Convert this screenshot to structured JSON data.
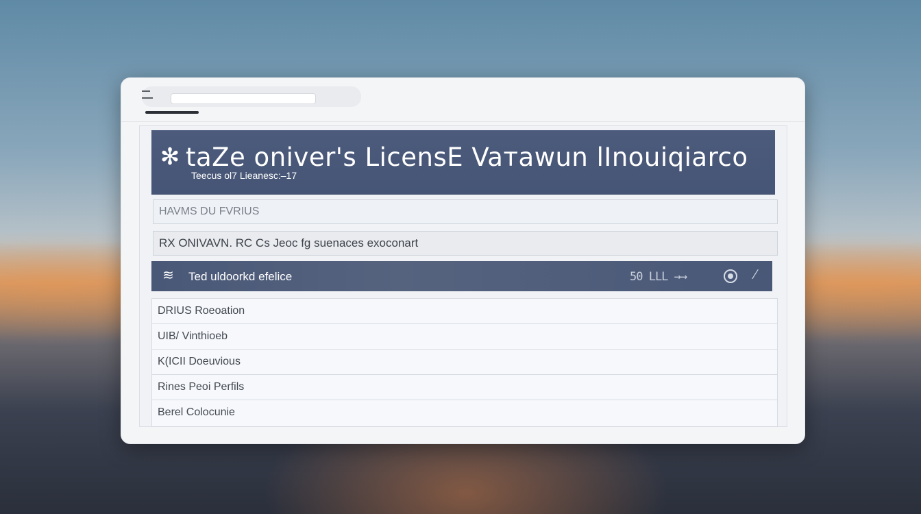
{
  "banner": {
    "icon": "snowflake-icon",
    "title": "taZe onivеr's LicensE Vaтawun lInouiqiarco",
    "subtitle": "Teecus  ol7 Lieanesc:–17"
  },
  "rows": {
    "row1": "HAVMS DU FVRIUS",
    "row2": "RX ONIVAVN. RC Cs Jeoc fg suenaces exoconart"
  },
  "section_bar": {
    "icon": "list-icon",
    "label": "Ted uldoorkd efelice",
    "value": "50 LLL →→",
    "circle_icon": "radio-icon",
    "edit_icon": "pencil-icon"
  },
  "list": {
    "items": [
      "DRIUS Roeoation",
      "UIB/  Vinthioeb",
      "K(ICII Doeuvious",
      "Rines Peoi Perfils",
      "Berel Colocunie"
    ]
  },
  "colors": {
    "banner": "#4c5b7c",
    "window": "#f4f5f7"
  }
}
